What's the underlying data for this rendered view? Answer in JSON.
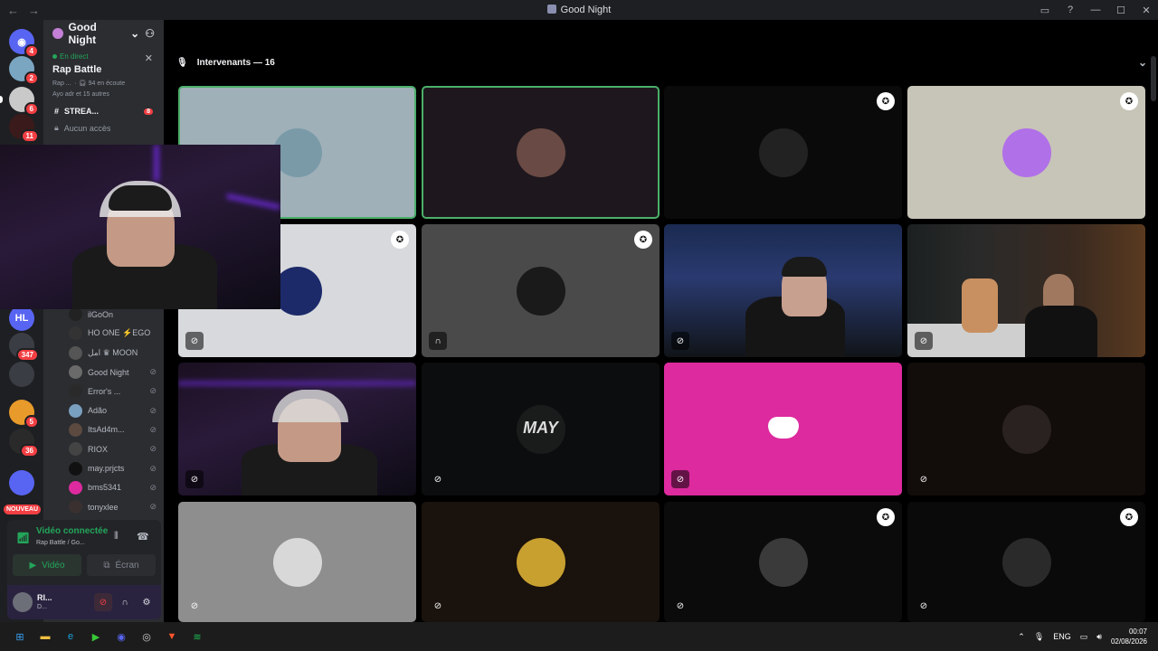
{
  "window": {
    "title": "Good Night"
  },
  "server_rail": [
    {
      "name": "discord-home",
      "badge": "4",
      "color": "#5865f2"
    },
    {
      "name": "server-2",
      "badge": "2",
      "color": "#7aa6c2"
    },
    {
      "name": "server-3",
      "badge": "6",
      "color": "#c9c9c9"
    },
    {
      "name": "server-4",
      "badge": "11",
      "color": "#3a1a1a"
    },
    {
      "name": "server-hl",
      "badge": "",
      "color": "#5865f2"
    },
    {
      "name": "server-6",
      "badge": "347",
      "color": "#3b3d44"
    },
    {
      "name": "server-7",
      "badge": "",
      "color": "#3b3d44"
    },
    {
      "name": "server-8",
      "badge": "5",
      "color": "#e89a2a"
    },
    {
      "name": "server-9",
      "badge": "36",
      "color": "#2a2a2a"
    },
    {
      "name": "folder",
      "badge": "",
      "color": "#5865f2"
    }
  ],
  "nouveau_label": "NOUVEAU",
  "sidebar": {
    "guild_name": "Good Night",
    "live": {
      "status": "En direct",
      "name": "Rap Battle",
      "meta_host": "Rap ...",
      "meta_listeners": "94 en écoute",
      "meta_people": "Ayo adr et 15 autres"
    },
    "channel_stream": "STREA...",
    "channel_stream_badge": "8",
    "channel_locked": "Aucun accès",
    "members": [
      {
        "name": "ilGoOn",
        "icon": ""
      },
      {
        "name": "HO ONE ⚡EGO",
        "icon": ""
      },
      {
        "name": "امل ♛ MOON",
        "icon": ""
      },
      {
        "name": "Good Night",
        "icon": "⊘"
      },
      {
        "name": "Error's ...",
        "icon": "⊘"
      },
      {
        "name": "Adão",
        "icon": "⊘"
      },
      {
        "name": "ItsAd4m...",
        "icon": "⊘"
      },
      {
        "name": "RIOX",
        "icon": "⊘"
      },
      {
        "name": "may.prjcts",
        "icon": "⊘"
      },
      {
        "name": "bms5341",
        "icon": "⊘"
      },
      {
        "name": "tonyxlee",
        "icon": "⊘"
      }
    ]
  },
  "voice": {
    "status": "Vidéo connectée",
    "channel": "Rap Battle / Go...",
    "video_label": "Vidéo",
    "screen_label": "Écran"
  },
  "user": {
    "name": "RI...",
    "status": "D..."
  },
  "stage": {
    "header": "Intervenants — 16"
  },
  "tiles": [
    {
      "bg": "#9fb0b8",
      "speaking": true,
      "shield": false,
      "mute": "",
      "av": "#7a9aa8"
    },
    {
      "bg": "#1e181e",
      "speaking": true,
      "shield": false,
      "mute": "",
      "av": "#6a4a44"
    },
    {
      "bg": "#0a0a0a",
      "speaking": false,
      "shield": true,
      "mute": "",
      "av": "#222222"
    },
    {
      "bg": "#c7c4b8",
      "speaking": false,
      "shield": true,
      "mute": "",
      "av": "#b070e8"
    },
    {
      "bg": "#d7d9dc",
      "speaking": false,
      "shield": true,
      "mute": "mic-off",
      "av": "#1c2a6a"
    },
    {
      "bg": "#4a4a4a",
      "speaking": false,
      "shield": true,
      "mute": "headset",
      "av": "#1a1a1a"
    },
    {
      "bg": "cam",
      "speaking": false,
      "shield": false,
      "mute": "mic-off",
      "av": ""
    },
    {
      "bg": "cam2",
      "speaking": false,
      "shield": false,
      "mute": "mic-off",
      "av": ""
    },
    {
      "bg": "cam3",
      "speaking": false,
      "shield": false,
      "mute": "mic-off",
      "av": ""
    },
    {
      "bg": "#0b0d0e",
      "speaking": false,
      "shield": false,
      "mute": "mic-off",
      "av": "#1a1c1c"
    },
    {
      "bg": "#dd2a9e",
      "speaking": false,
      "shield": false,
      "mute": "mic-off",
      "av": ""
    },
    {
      "bg": "#120c0a",
      "speaking": false,
      "shield": false,
      "mute": "mic-off",
      "av": "#2a2220"
    },
    {
      "bg": "#8e8e8e",
      "speaking": false,
      "shield": false,
      "mute": "mic-off",
      "av": "#d8d8d8"
    },
    {
      "bg": "#1a120c",
      "speaking": false,
      "shield": false,
      "mute": "mic-off",
      "av": "#c8a030"
    },
    {
      "bg": "#0b0b0b",
      "speaking": false,
      "shield": true,
      "mute": "mic-off",
      "av": "#3a3a3a"
    },
    {
      "bg": "#0a0a0a",
      "speaking": false,
      "shield": true,
      "mute": "mic-off",
      "av": "#2a2a2a"
    }
  ],
  "tile_texts": {
    "may_logo": "MAY"
  },
  "taskbar": {
    "apps": [
      {
        "name": "windows-start",
        "color": "#3aa0f0",
        "glyph": "⊞"
      },
      {
        "name": "file-explorer",
        "color": "#f0c040",
        "glyph": "▬"
      },
      {
        "name": "edge",
        "color": "#1aa0d8",
        "glyph": "e"
      },
      {
        "name": "app-green",
        "color": "#38c838",
        "glyph": "▶"
      },
      {
        "name": "discord",
        "color": "#5865f2",
        "glyph": "◉"
      },
      {
        "name": "app-ring",
        "color": "#cccccc",
        "glyph": "◎"
      },
      {
        "name": "brave",
        "color": "#fb542b",
        "glyph": "▼"
      },
      {
        "name": "spotify",
        "color": "#1db954",
        "glyph": "≋"
      }
    ],
    "lang": "ENG",
    "time": "00:07",
    "date": "02/08/2026"
  }
}
